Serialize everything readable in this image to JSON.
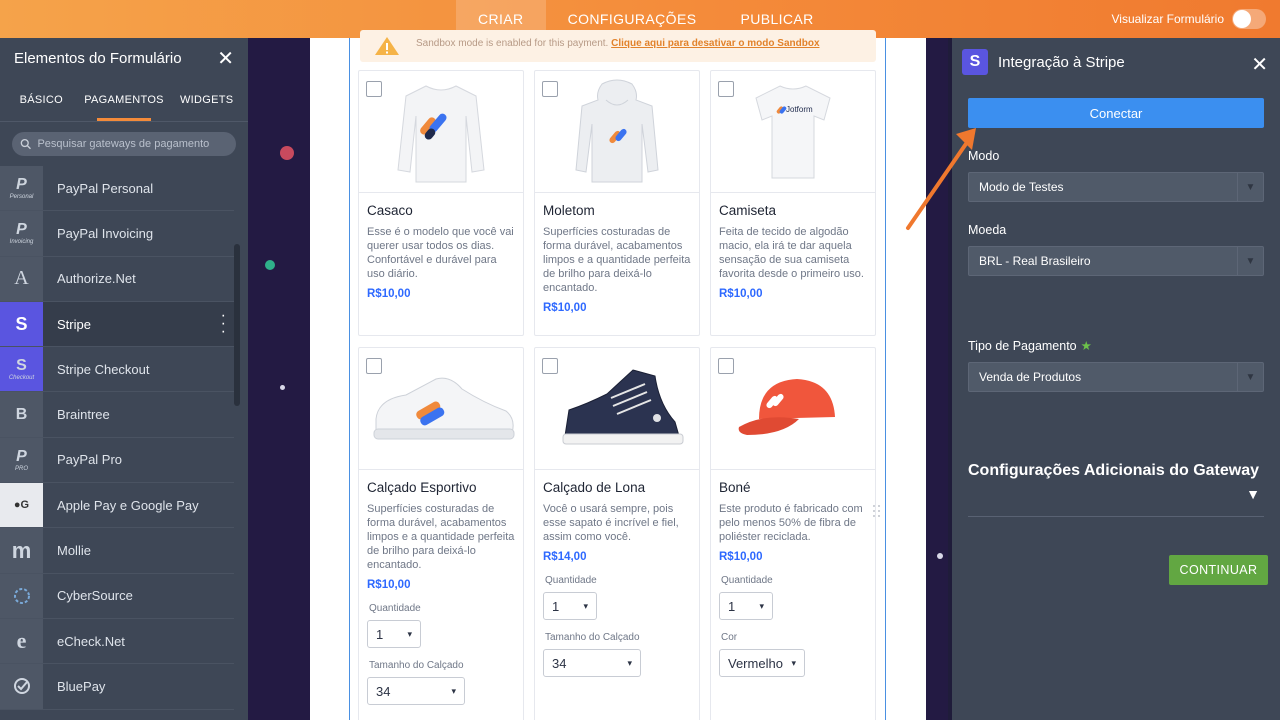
{
  "topbar": {
    "tabs": [
      {
        "label": "CRIAR",
        "active": true
      },
      {
        "label": "CONFIGURAÇÕES",
        "active": false
      },
      {
        "label": "PUBLICAR",
        "active": false
      }
    ],
    "preview_label": "Visualizar Formulário"
  },
  "left_panel": {
    "title": "Elementos do Formulário",
    "tabs": [
      "BÁSICO",
      "PAGAMENTOS",
      "WIDGETS"
    ],
    "active_tab": "PAGAMENTOS",
    "search_placeholder": "Pesquisar gateways de pagamento",
    "items": [
      {
        "label": "PayPal Personal",
        "icon": "paypal-icon",
        "icon_caption": "Personal"
      },
      {
        "label": "PayPal Invoicing",
        "icon": "paypal-icon",
        "icon_caption": "Invoicing"
      },
      {
        "label": "Authorize.Net",
        "icon": "authorize-net-icon",
        "icon_glyph": "A"
      },
      {
        "label": "Stripe",
        "icon": "stripe-icon",
        "icon_glyph": "S",
        "active": true
      },
      {
        "label": "Stripe Checkout",
        "icon": "stripe-checkout-icon",
        "icon_glyph": "S",
        "icon_caption": "Checkout"
      },
      {
        "label": "Braintree",
        "icon": "braintree-icon",
        "icon_glyph": "B"
      },
      {
        "label": "PayPal Pro",
        "icon": "paypal-icon",
        "icon_caption": "PRO"
      },
      {
        "label": "Apple Pay e Google Pay",
        "icon": "apple-google-pay-icon"
      },
      {
        "label": "Mollie",
        "icon": "mollie-icon",
        "icon_glyph": "m"
      },
      {
        "label": "CyberSource",
        "icon": "cybersource-icon"
      },
      {
        "label": "eCheck.Net",
        "icon": "echeck-icon",
        "icon_glyph": "e"
      },
      {
        "label": "BluePay",
        "icon": "bluepay-icon"
      }
    ]
  },
  "form": {
    "sandbox_text": "Sandbox mode is enabled for this payment.",
    "sandbox_link": "Clique aqui para desativar o modo Sandbox",
    "products": [
      {
        "name": "Casaco",
        "description": "Esse é o modelo que você vai querer usar todos os dias. Confortável e durável para uso diário.",
        "price": "R$10,00",
        "image": "sweatshirt-image"
      },
      {
        "name": "Moletom",
        "description": "Superfícies costuradas de forma durável, acabamentos limpos e a quantidade perfeita de brilho para deixá-lo encantado.",
        "price": "R$10,00",
        "image": "hoodie-image"
      },
      {
        "name": "Camiseta",
        "description": "Feita de tecido de algodão macio, ela irá te dar aquela sensação de sua camiseta favorita desde o primeiro uso.",
        "price": "R$10,00",
        "image": "tshirt-image",
        "brand": "Jotform"
      },
      {
        "name": "Calçado Esportivo",
        "description": "Superfícies costuradas de forma durável, acabamentos limpos e a quantidade perfeita de brilho para deixá-lo encantado.",
        "price": "R$10,00",
        "image": "sneaker-image",
        "options": [
          {
            "label": "Quantidade",
            "value": "1"
          },
          {
            "label": "Tamanho do Calçado",
            "value": "34"
          }
        ]
      },
      {
        "name": "Calçado de Lona",
        "description": "Você o usará sempre, pois esse sapato é incrível e fiel, assim como você.",
        "price": "R$14,00",
        "image": "canvas-shoe-image",
        "options": [
          {
            "label": "Quantidade",
            "value": "1"
          },
          {
            "label": "Tamanho do Calçado",
            "value": "34"
          }
        ]
      },
      {
        "name": "Boné",
        "description": "Este produto é fabricado com pelo menos 50% de fibra de poliéster reciclada.",
        "price": "R$10,00",
        "image": "cap-image",
        "options": [
          {
            "label": "Quantidade",
            "value": "1"
          },
          {
            "label": "Cor",
            "value": "Vermelho"
          }
        ]
      }
    ]
  },
  "right_panel": {
    "title": "Integração à Stripe",
    "connect_label": "Conectar",
    "mode_label": "Modo",
    "mode_value": "Modo de Testes",
    "currency_label": "Moeda",
    "currency_value": "BRL - Real Brasileiro",
    "payment_type_label": "Tipo de Pagamento",
    "payment_type_value": "Venda de Produtos",
    "additional_settings": "Configurações Adicionais do Gateway",
    "continue_label": "CONTINUAR"
  },
  "colors": {
    "accent_orange": "#f48b3a",
    "stripe_purple": "#5a55e0",
    "connect_blue": "#3b8ff0",
    "continue_green": "#62a742",
    "price_blue": "#2e69ff"
  }
}
